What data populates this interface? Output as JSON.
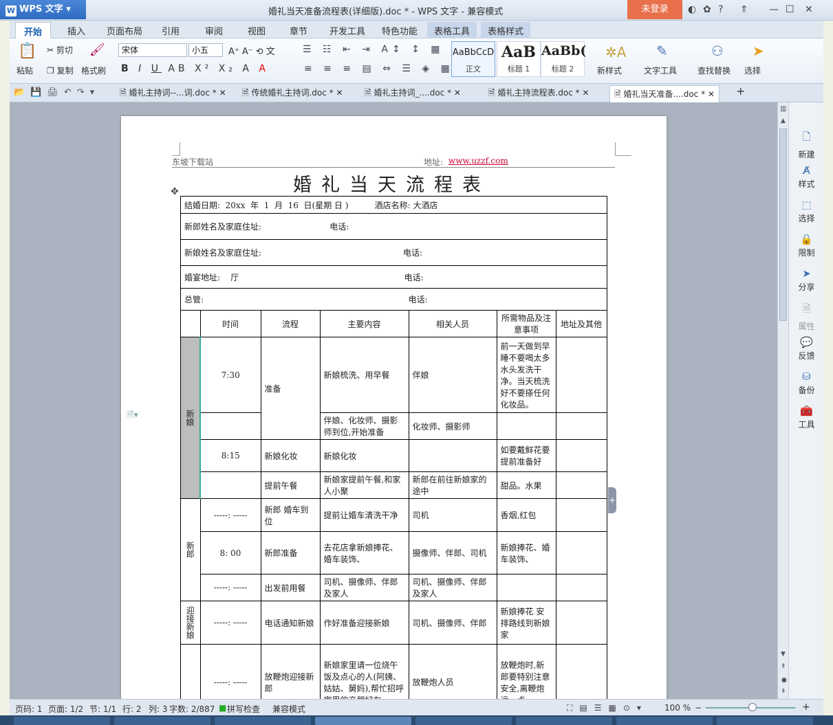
{
  "app": {
    "name": "WPS 文字",
    "window_title": "婚礼当天准备流程表(详细版).doc * - WPS 文字 - 兼容模式",
    "login": "未登录"
  },
  "menu_tabs": [
    "开始",
    "插入",
    "页面布局",
    "引用",
    "审阅",
    "视图",
    "章节",
    "开发工具",
    "特色功能",
    "表格工具",
    "表格样式"
  ],
  "ribbon": {
    "paste": "粘贴",
    "cut": "剪切",
    "copy": "复制",
    "format_painter": "格式刷",
    "font": "宋体",
    "size": "小五",
    "styles": [
      {
        "preview": "AaBbCcD",
        "label": "正文"
      },
      {
        "preview": "AaB",
        "label": "标题 1"
      },
      {
        "preview": "AaBb(",
        "label": "标题 2"
      }
    ],
    "new_style": "新样式",
    "text_tools": "文字工具",
    "find_replace": "查找替换",
    "select": "选择"
  },
  "doc_tabs": [
    "婚礼主持词--...词.doc *",
    "传统婚礼主持词.doc *",
    "婚礼主持词_....doc *",
    "婚礼主持流程表.doc *",
    "婚礼当天准备....doc *"
  ],
  "right_panel": [
    "新建",
    "样式",
    "选择",
    "限制",
    "分享",
    "属性",
    "反馈",
    "备份",
    "工具"
  ],
  "status": {
    "page_code": "页码: 1",
    "pages": "页面: 1/2",
    "section": "节: 1/1",
    "row": "行: 2",
    "col": "列: 3",
    "words": "字数: 2/887",
    "spell": "拼写检查",
    "mode": "兼容模式",
    "zoom": "100 %"
  },
  "document": {
    "header_left": "东坡下载站",
    "header_right_label": "地址:",
    "header_right_url": "www.uzzf.com",
    "title": "婚礼当天流程表",
    "info": [
      "结婚日期:  20xx  年  1  月  16  日(星期 日 )          酒店名称: 大酒店",
      "新郎姓名及家庭住址:                          电话:",
      "新娘姓名及家庭住址:                                                      电话:",
      "婚宴地址:    厅                                                               电话:",
      "总管:                                                                              电话:"
    ],
    "columns": [
      "",
      "时间",
      "流程",
      "主要内容",
      "相关人员",
      "所需物品及注意事项",
      "地址及其他"
    ],
    "groups": {
      "bride": "新娘",
      "groom": "新郎",
      "welcome": "迎接新娘"
    },
    "rows": [
      {
        "time": "7:30",
        "flow": "准备",
        "content": "新娘梳洗、用早餐",
        "people": "伴娘",
        "items": "前一天做到早睡不要喝太多水头发洗干净。当天梳洗好不要搽任何化妆品。"
      },
      {
        "content": "伴娘、化妆师、摄影师到位,开始准备",
        "people": "化妆师、摄影师"
      },
      {
        "time": "8:15",
        "flow": "新娘化妆",
        "content": "新娘化妆",
        "items": "如要戴鲜花要提前准备好"
      },
      {
        "flow": "提前午餐",
        "content": "新娘家提前午餐,和家人小聚",
        "people": "新郎在前往新娘家的途中",
        "items": "甜品。水果"
      },
      {
        "time": "-----: -----",
        "flow": "新郎 婚车到位",
        "content": "提前让婚车清洗干净",
        "people": "司机",
        "items": "香烟,红包"
      },
      {
        "time": "8: 00",
        "flow": "新郎准备",
        "content": "去花店拿新娘捧花、婚车装饰、",
        "people": "摄像师、伴郎、司机",
        "items": "新娘捧花、婚车装饰、"
      },
      {
        "time": "-----: -----",
        "flow": "出发前用餐",
        "content": "司机、摄像师、伴郎及家人",
        "people": "司机、摄像师、伴郎及家人"
      },
      {
        "time": "-----: -----",
        "flow": "电话通知新娘",
        "content": "作好准备迎接新娘",
        "people": "司机、摄像师、伴郎",
        "items": "新娘捧花 安排路线到新娘家"
      },
      {
        "time": "-----: -----",
        "flow": "放鞭炮迎接新郎",
        "content": "新娘家里请一位烧午饭及点心的人(阿姨、姑姑、舅妈),帮忙招呼家里的亲朋好友。",
        "people": "放鞭炮人员",
        "items": "放鞭炮时,新郎要特别注意安全,离鞭炮远一点"
      }
    ]
  }
}
